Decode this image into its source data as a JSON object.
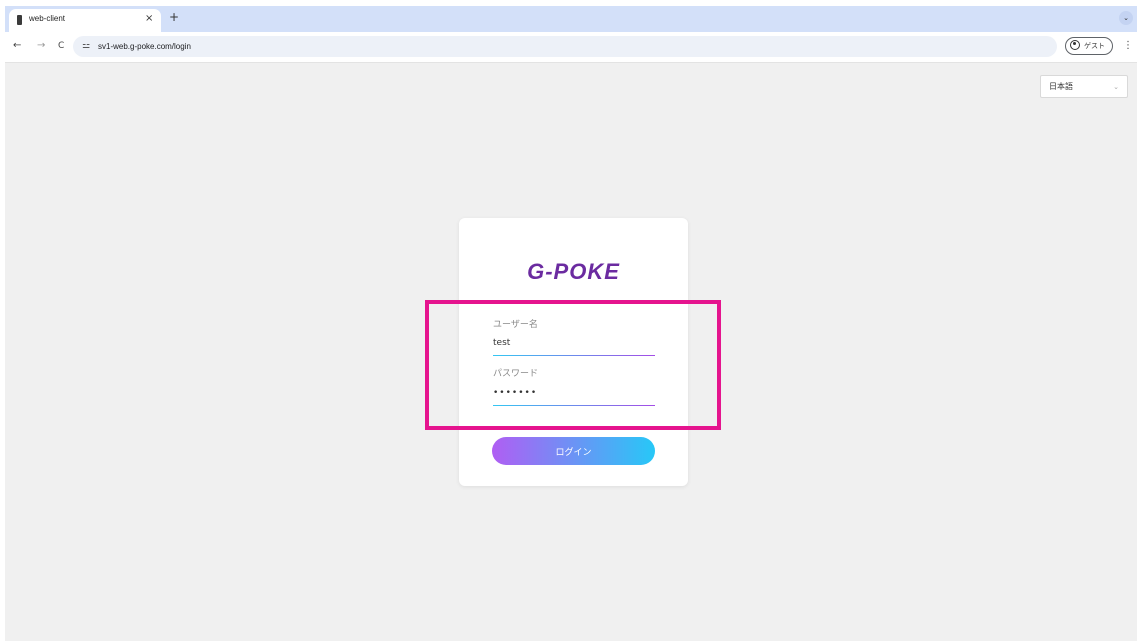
{
  "browser": {
    "tab_title": "web-client",
    "tab_close": "×",
    "new_tab": "+",
    "tab_menu": "⌄",
    "nav": {
      "back": "←",
      "forward": "→",
      "reload": "C"
    },
    "site_info_icon": "⚍",
    "url": "sv1-web.g-poke.com/login",
    "profile_label": "ゲスト",
    "menu": "⋮"
  },
  "language_select": {
    "value": "日本語",
    "chevron": "⌄"
  },
  "login": {
    "logo": "G-POKE",
    "username_label": "ユーザー名",
    "username_value": "test",
    "password_label": "パスワード",
    "password_value": "•••••••",
    "submit_label": "ログイン"
  },
  "colors": {
    "brand": "#6b2ba0",
    "button_gradient_start": "#b05ef3",
    "button_gradient_end": "#27c8f7",
    "highlight": "#e5148e",
    "page_background": "#f0f0f0"
  }
}
